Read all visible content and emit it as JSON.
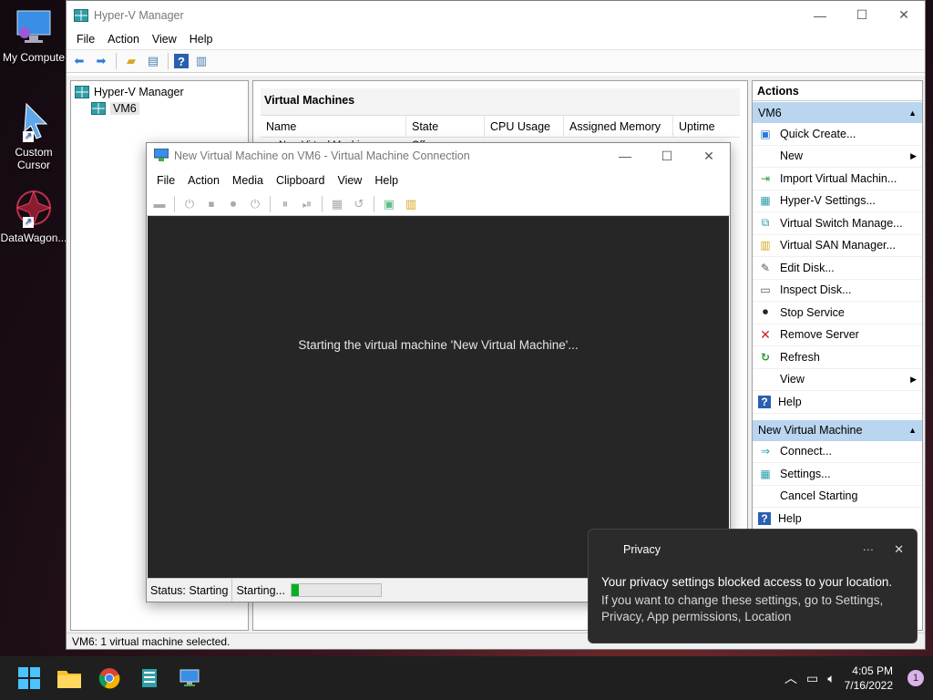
{
  "desktop": {
    "icons": [
      {
        "label": "My Compute"
      },
      {
        "label": "Custom\nCursor"
      },
      {
        "label": "DataWagon..."
      }
    ]
  },
  "hyperv": {
    "title": "Hyper-V Manager",
    "menu": [
      "File",
      "Action",
      "View",
      "Help"
    ],
    "tree": {
      "root": "Hyper-V Manager",
      "child": "VM6"
    },
    "vm_panel_title": "Virtual Machines",
    "columns": [
      "Name",
      "State",
      "CPU Usage",
      "Assigned Memory",
      "Uptime"
    ],
    "rows": [
      {
        "name": "New Virtual Machine",
        "state": "Off"
      }
    ],
    "actions_title": "Actions",
    "sections": [
      {
        "title": "VM6",
        "items": [
          {
            "label": "Quick Create...",
            "icon": "quick-create-icon"
          },
          {
            "label": "New",
            "icon": "none",
            "submenu": true
          },
          {
            "label": "Import Virtual Machin...",
            "icon": "import-icon"
          },
          {
            "label": "Hyper-V Settings...",
            "icon": "settings-icon"
          },
          {
            "label": "Virtual Switch Manage...",
            "icon": "switch-icon"
          },
          {
            "label": "Virtual SAN Manager...",
            "icon": "san-icon"
          },
          {
            "label": "Edit Disk...",
            "icon": "edit-disk-icon"
          },
          {
            "label": "Inspect Disk...",
            "icon": "inspect-disk-icon"
          },
          {
            "label": "Stop Service",
            "icon": "stop-icon"
          },
          {
            "label": "Remove Server",
            "icon": "remove-icon"
          },
          {
            "label": "Refresh",
            "icon": "refresh-icon"
          },
          {
            "label": "View",
            "icon": "none",
            "submenu": true
          },
          {
            "label": "Help",
            "icon": "help-icon"
          }
        ]
      },
      {
        "title": "New Virtual Machine",
        "items": [
          {
            "label": "Connect...",
            "icon": "connect-icon"
          },
          {
            "label": "Settings...",
            "icon": "settings-icon"
          },
          {
            "label": "Cancel Starting",
            "icon": "none"
          },
          {
            "label": "Help",
            "icon": "help-icon"
          }
        ]
      }
    ],
    "status": "VM6:  1 virtual machine selected."
  },
  "vmconnect": {
    "title": "New Virtual Machine on VM6 - Virtual Machine Connection",
    "menu": [
      "File",
      "Action",
      "Media",
      "Clipboard",
      "View",
      "Help"
    ],
    "message": "Starting the virtual machine 'New Virtual Machine'...",
    "status_label": "Status: Starting",
    "status_detail": "Starting...",
    "progress_fraction": 0.08
  },
  "toast": {
    "app": "Privacy",
    "more": "···",
    "close": "✕",
    "title": "Your privacy settings blocked access to your location.",
    "body": "If you want to change these settings, go to Settings, Privacy, App permissions, Location"
  },
  "taskbar": {
    "time": "4:05 PM",
    "date": "7/16/2022",
    "notification_count": "1"
  },
  "colors": {
    "accent_selected": "#b9d5ef",
    "progress": "#06b025",
    "vm_screen": "#262626"
  }
}
